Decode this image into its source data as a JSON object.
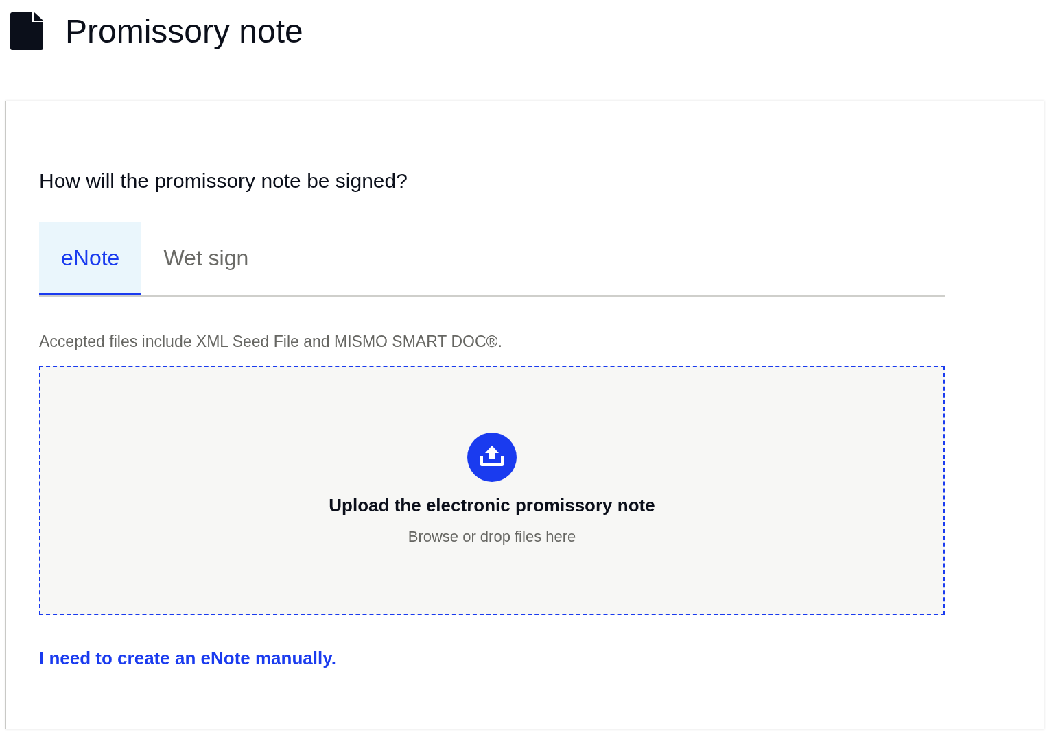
{
  "page": {
    "title": "Promissory note"
  },
  "card": {
    "question": "How will the promissory note be signed?",
    "tabs": [
      {
        "label": "eNote",
        "selected": true
      },
      {
        "label": "Wet sign",
        "selected": false
      }
    ],
    "hint": "Accepted files include XML Seed File and MISMO SMART DOC®.",
    "dropzone": {
      "title": "Upload the electronic promissory note",
      "subtitle": "Browse or drop files here"
    },
    "link": "I need to create an eNote manually."
  }
}
